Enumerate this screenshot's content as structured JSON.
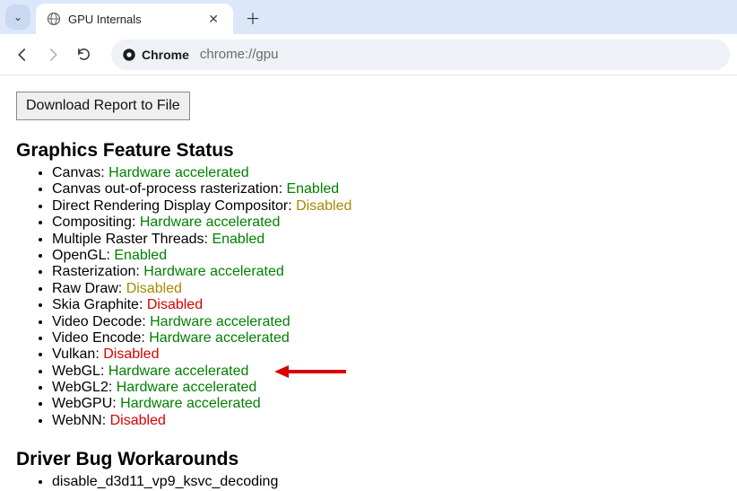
{
  "browser": {
    "tab_title": "GPU Internals",
    "address_label": "Chrome",
    "url": "chrome://gpu"
  },
  "download_button": "Download Report to File",
  "sections": {
    "graphics_status_heading": "Graphics Feature Status",
    "driver_bugs_heading": "Driver Bug Workarounds"
  },
  "features": [
    {
      "name": "Canvas",
      "status": "Hardware accelerated",
      "class": "status-hw"
    },
    {
      "name": "Canvas out-of-process rasterization",
      "status": "Enabled",
      "class": "status-enabled"
    },
    {
      "name": "Direct Rendering Display Compositor",
      "status": "Disabled",
      "class": "status-disabled-warn"
    },
    {
      "name": "Compositing",
      "status": "Hardware accelerated",
      "class": "status-hw"
    },
    {
      "name": "Multiple Raster Threads",
      "status": "Enabled",
      "class": "status-enabled"
    },
    {
      "name": "OpenGL",
      "status": "Enabled",
      "class": "status-enabled"
    },
    {
      "name": "Rasterization",
      "status": "Hardware accelerated",
      "class": "status-hw"
    },
    {
      "name": "Raw Draw",
      "status": "Disabled",
      "class": "status-disabled-warn"
    },
    {
      "name": "Skia Graphite",
      "status": "Disabled",
      "class": "status-disabled-err"
    },
    {
      "name": "Video Decode",
      "status": "Hardware accelerated",
      "class": "status-hw"
    },
    {
      "name": "Video Encode",
      "status": "Hardware accelerated",
      "class": "status-hw"
    },
    {
      "name": "Vulkan",
      "status": "Disabled",
      "class": "status-disabled-err"
    },
    {
      "name": "WebGL",
      "status": "Hardware accelerated",
      "class": "status-hw",
      "arrow": true
    },
    {
      "name": "WebGL2",
      "status": "Hardware accelerated",
      "class": "status-hw"
    },
    {
      "name": "WebGPU",
      "status": "Hardware accelerated",
      "class": "status-hw"
    },
    {
      "name": "WebNN",
      "status": "Disabled",
      "class": "status-disabled-err"
    }
  ],
  "driver_workarounds": [
    "disable_d3d11_vp9_ksvc_decoding"
  ]
}
